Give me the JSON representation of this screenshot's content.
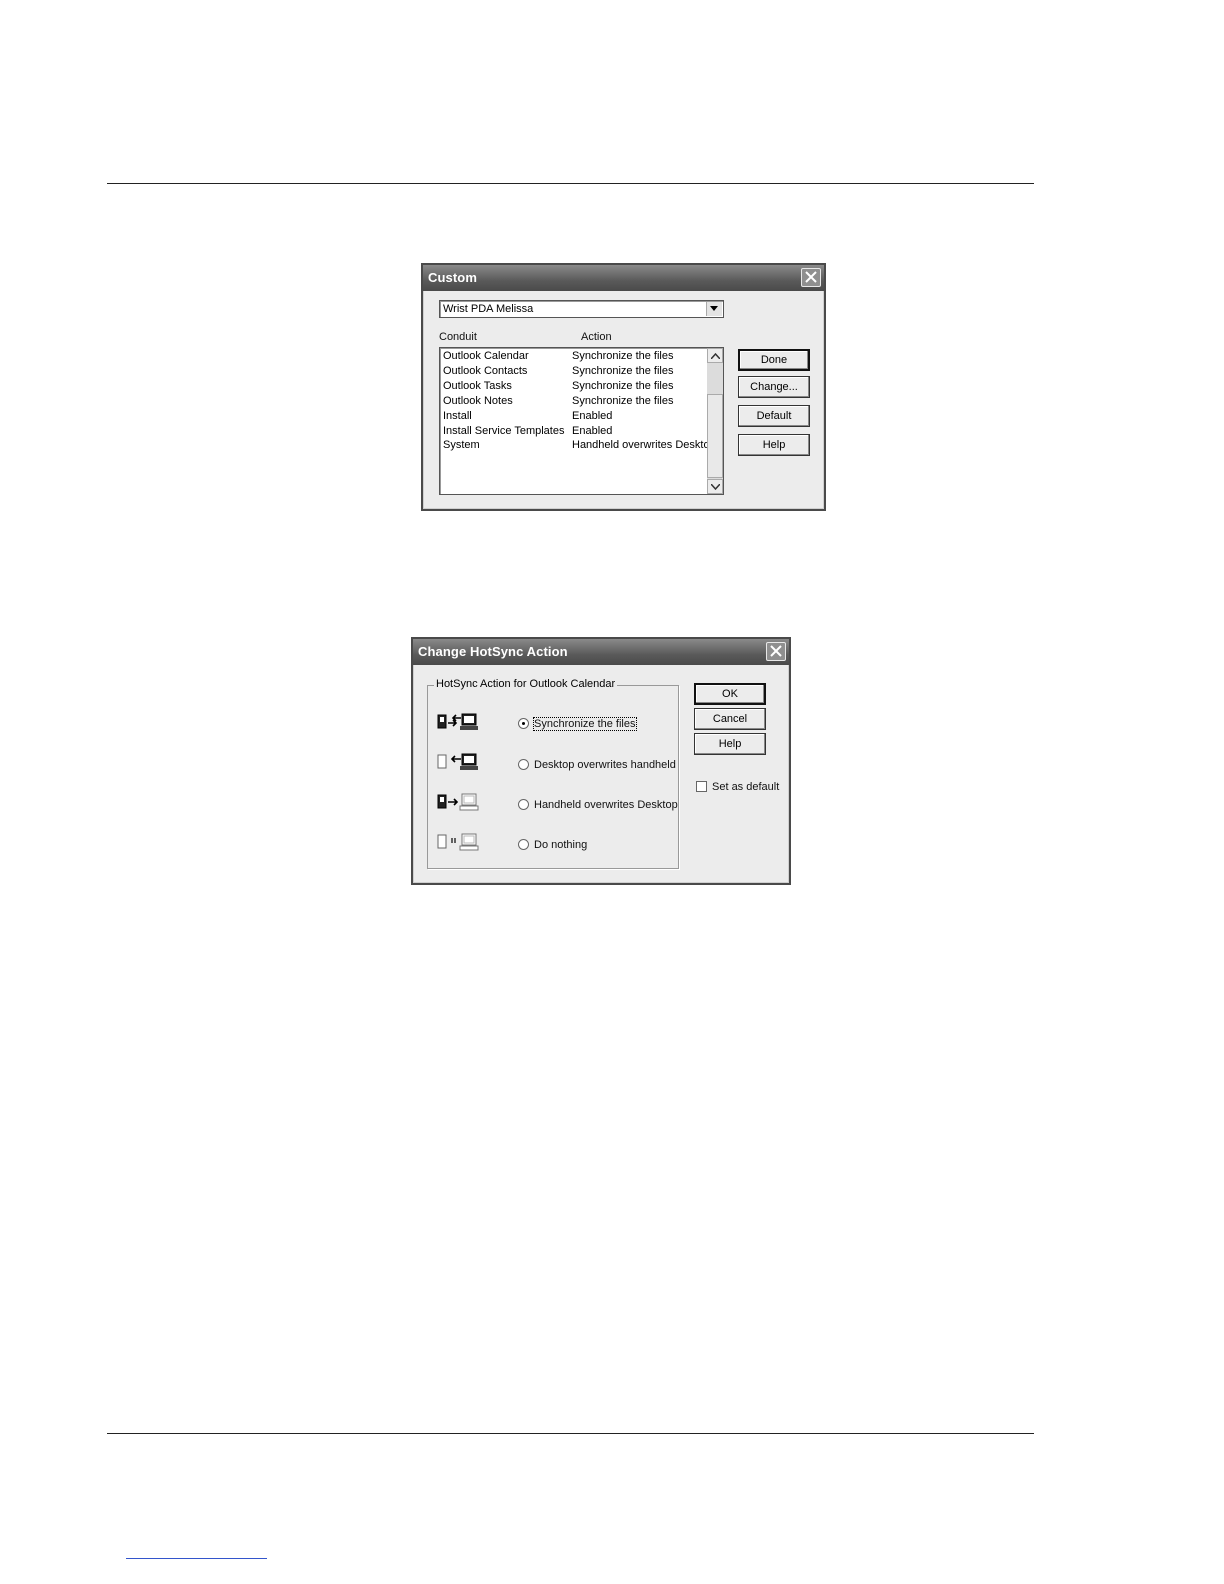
{
  "custom": {
    "title": "Custom",
    "user_select": "Wrist PDA Melissa",
    "columns": {
      "conduit": "Conduit",
      "action": "Action"
    },
    "rows": [
      {
        "conduit": "Outlook Calendar",
        "action": "Synchronize the files"
      },
      {
        "conduit": "Outlook Contacts",
        "action": "Synchronize the files"
      },
      {
        "conduit": "Outlook Tasks",
        "action": "Synchronize the files"
      },
      {
        "conduit": "Outlook Notes",
        "action": "Synchronize the files"
      },
      {
        "conduit": "Install",
        "action": "Enabled"
      },
      {
        "conduit": "Install Service Templates",
        "action": "Enabled"
      },
      {
        "conduit": "System",
        "action": "Handheld overwrites Desktop"
      }
    ],
    "buttons": {
      "done": "Done",
      "change": "Change...",
      "default": "Default",
      "help": "Help"
    }
  },
  "change": {
    "title": "Change HotSync Action",
    "group_label": "HotSync Action for Outlook Calendar",
    "options": [
      {
        "label": "Synchronize the files",
        "selected": true,
        "icon": "sync-both-icon"
      },
      {
        "label": "Desktop overwrites handheld",
        "selected": false,
        "icon": "desktop-to-handheld-icon"
      },
      {
        "label": "Handheld overwrites Desktop",
        "selected": false,
        "icon": "handheld-to-desktop-icon"
      },
      {
        "label": "Do nothing",
        "selected": false,
        "icon": "do-nothing-icon"
      }
    ],
    "buttons": {
      "ok": "OK",
      "cancel": "Cancel",
      "help": "Help"
    },
    "set_default": "Set as default"
  }
}
